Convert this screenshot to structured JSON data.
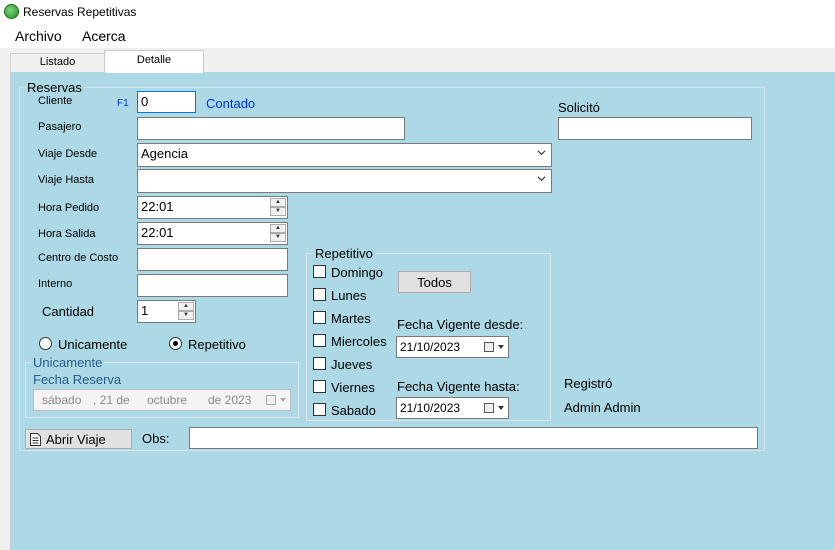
{
  "window": {
    "title": "Reservas Repetitivas"
  },
  "menu": {
    "archivo": "Archivo",
    "acerca": "Acerca"
  },
  "tabs": {
    "listado": "Listado",
    "detalle": "Detalle"
  },
  "reservas": {
    "group_title": "Reservas",
    "cliente_label": "Cliente",
    "f1_label": "F1",
    "cliente_value": "0",
    "contado_label": "Contado",
    "solicito_label": "Solicitó",
    "solicito_value": "",
    "pasajero_label": "Pasajero",
    "pasajero_value": "",
    "viaje_desde_label": "Viaje Desde",
    "viaje_desde_value": "Agencia",
    "viaje_hasta_label": "Viaje Hasta",
    "viaje_hasta_value": "",
    "hora_pedido_label": "Hora Pedido",
    "hora_pedido_value": "22:01",
    "hora_salida_label": "Hora Salida",
    "hora_salida_value": "22:01",
    "centro_costo_label": "Centro de Costo",
    "centro_costo_value": "",
    "interno_label": "Interno",
    "interno_value": "",
    "cantidad_label": "Cantidad",
    "cantidad_value": "1",
    "unicamente_radio": "Unicamente",
    "repetitivo_radio": "Repetitivo",
    "selected_mode": "Repetitivo"
  },
  "unicamente": {
    "group_title": "Unicamente",
    "fecha_reserva_label": "Fecha Reserva",
    "fecha_reserva": {
      "weekday": "sábado",
      "day": ", 21 de",
      "month": "octubre",
      "year": "de 2023"
    }
  },
  "repetitivo": {
    "group_title": "Repetitivo",
    "days": [
      "Domingo",
      "Lunes",
      "Martes",
      "Miercoles",
      "Jueves",
      "Viernes",
      "Sabado"
    ],
    "todos_button": "Todos",
    "fecha_desde_label": "Fecha Vigente desde:",
    "fecha_desde_value": "21/10/2023",
    "fecha_hasta_label": "Fecha Vigente hasta:",
    "fecha_hasta_value": "21/10/2023"
  },
  "registro": {
    "registro_label": "Registró",
    "user_name": "Admin Admin"
  },
  "footer": {
    "abrir_viaje_button": "Abrir Viaje",
    "obs_label": "Obs:",
    "obs_value": ""
  },
  "colors": {
    "panel_bg": "#add8e6",
    "link_blue": "#0033cc",
    "label_blue": "#2a5a8a"
  }
}
